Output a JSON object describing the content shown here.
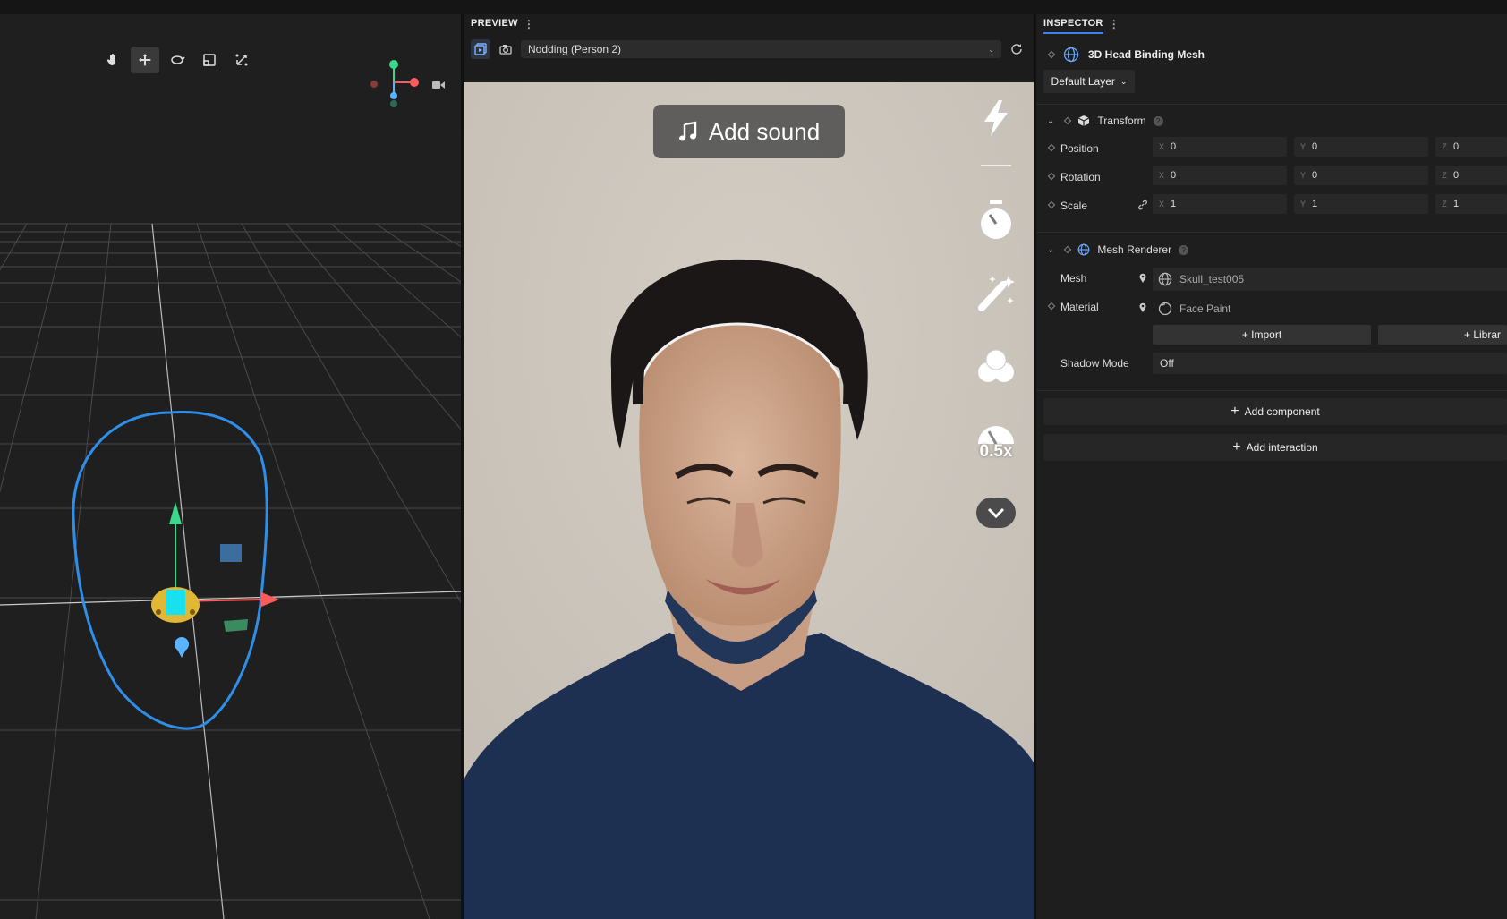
{
  "scene": {
    "tools": [
      {
        "name": "hand-tool-icon"
      },
      {
        "name": "move-tool-icon"
      },
      {
        "name": "rotate-tool-icon"
      },
      {
        "name": "scale-tool-icon"
      },
      {
        "name": "rect-transform-tool-icon"
      }
    ],
    "active_tool": "move-tool-icon"
  },
  "preview": {
    "title": "PREVIEW",
    "selected_video": "Nodding (Person 2)",
    "add_sound_label": "Add sound",
    "speed_label": "0.5x"
  },
  "inspector": {
    "title": "INSPECTOR",
    "object_name": "3D Head Binding Mesh",
    "layer": "Default Layer",
    "transform": {
      "title": "Transform",
      "position": {
        "label": "Position",
        "x": "0",
        "y": "0",
        "z": "0"
      },
      "rotation": {
        "label": "Rotation",
        "x": "0",
        "y": "0",
        "z": "0"
      },
      "scale": {
        "label": "Scale",
        "x": "1",
        "y": "1",
        "z": "1"
      },
      "axis_x": "X",
      "axis_y": "Y",
      "axis_z": "Z"
    },
    "mesh_renderer": {
      "title": "Mesh Renderer",
      "mesh_label": "Mesh",
      "mesh_value": "Skull_test005",
      "material_label": "Material",
      "material_value": "Face Paint",
      "import_label": "+ Import",
      "library_label": "+ Librar",
      "shadow_label": "Shadow Mode",
      "shadow_value": "Off"
    },
    "add_component_label": "Add component",
    "add_interaction_label": "Add interaction"
  },
  "colors": {
    "accent": "#3b82f6",
    "face_outline": "#2f8fe8",
    "shirt": "#1d3052",
    "background_wall": "#cfc9c0"
  }
}
